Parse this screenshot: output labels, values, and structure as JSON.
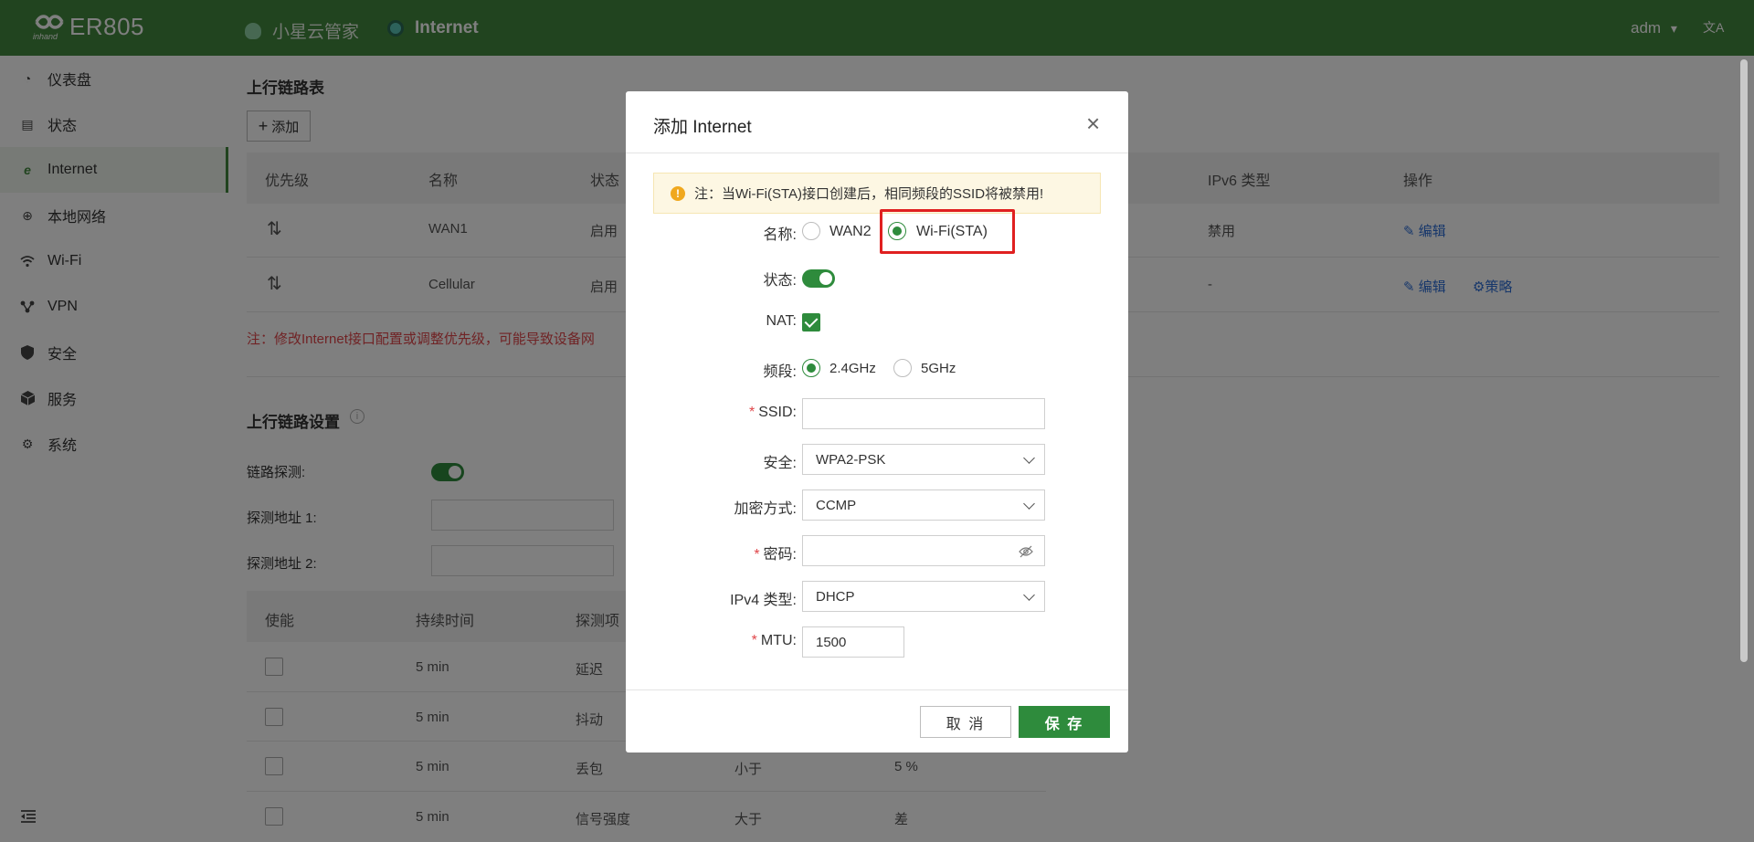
{
  "header": {
    "logo_text": "ER805",
    "nav_cloud": "小星云管家",
    "nav_internet": "Internet",
    "user": "adm",
    "user_caret": "▾",
    "lang_glyph": "文A"
  },
  "sidebar": {
    "items": [
      {
        "label": "仪表盘",
        "icon": "dashboard-icon"
      },
      {
        "label": "状态",
        "icon": "status-icon"
      },
      {
        "label": "Internet",
        "icon": "internet-icon",
        "active": true
      },
      {
        "label": "本地网络",
        "icon": "globe-icon"
      },
      {
        "label": "Wi-Fi",
        "icon": "wifi-icon"
      },
      {
        "label": "VPN",
        "icon": "vpn-icon"
      },
      {
        "label": "安全",
        "icon": "shield-icon"
      },
      {
        "label": "服务",
        "icon": "cube-icon"
      },
      {
        "label": "系统",
        "icon": "gear-icon"
      }
    ]
  },
  "uplink_table": {
    "title": "上行链路表",
    "add_label": "添加",
    "columns": [
      "优先级",
      "名称",
      "状态",
      "IPv6 类型",
      "操作"
    ],
    "rows": [
      {
        "name": "WAN1",
        "status": "启用",
        "ipv6": "禁用",
        "actions": [
          "编辑"
        ]
      },
      {
        "name": "Cellular",
        "status": "启用",
        "ipv6": "-",
        "actions": [
          "编辑",
          "策略"
        ]
      }
    ],
    "note": "注：修改Internet接口配置或调整优先级，可能导致设备网"
  },
  "uplink_settings": {
    "title": "上行链路设置",
    "probe_label": "链路探测:",
    "probe_addr1_label": "探测地址 1:",
    "probe_addr2_label": "探测地址 2:",
    "columns": [
      "使能",
      "持续时间",
      "探测项"
    ],
    "rows": [
      {
        "duration": "5 min",
        "item": "延迟",
        "cmp": "",
        "value": ""
      },
      {
        "duration": "5 min",
        "item": "抖动",
        "cmp": "",
        "value": ""
      },
      {
        "duration": "5 min",
        "item": "丢包",
        "cmp": "小于",
        "value": "5 %"
      },
      {
        "duration": "5 min",
        "item": "信号强度",
        "cmp": "大于",
        "value": "差"
      }
    ]
  },
  "modal": {
    "title": "添加 Internet",
    "close": "×",
    "warning": "注：当Wi-Fi(STA)接口创建后，相同频段的SSID将被禁用!",
    "warning_icon": "!",
    "name_label": "名称:",
    "name_options": [
      "WAN2",
      "Wi-Fi(STA)"
    ],
    "name_selected": "Wi-Fi(STA)",
    "status_label": "状态:",
    "status_on": true,
    "nat_label": "NAT:",
    "nat_checked": true,
    "band_label": "频段:",
    "band_options": [
      "2.4GHz",
      "5GHz"
    ],
    "band_selected": "2.4GHz",
    "ssid_label": "SSID:",
    "ssid_value": "",
    "security_label": "安全:",
    "security_value": "WPA2-PSK",
    "encryption_label": "加密方式:",
    "encryption_value": "CCMP",
    "password_label": "密码:",
    "password_value": "",
    "ipv4_label": "IPv4 类型:",
    "ipv4_value": "DHCP",
    "mtu_label": "MTU:",
    "mtu_value": "1500",
    "required_mark": "*",
    "cancel_label": "取 消",
    "save_label": "保 存"
  },
  "colors": {
    "header_bg": "#43883f",
    "primary": "#2e8b3c",
    "link": "#2f6fd6",
    "danger": "#e0464a",
    "highlight_box": "#e02020"
  }
}
